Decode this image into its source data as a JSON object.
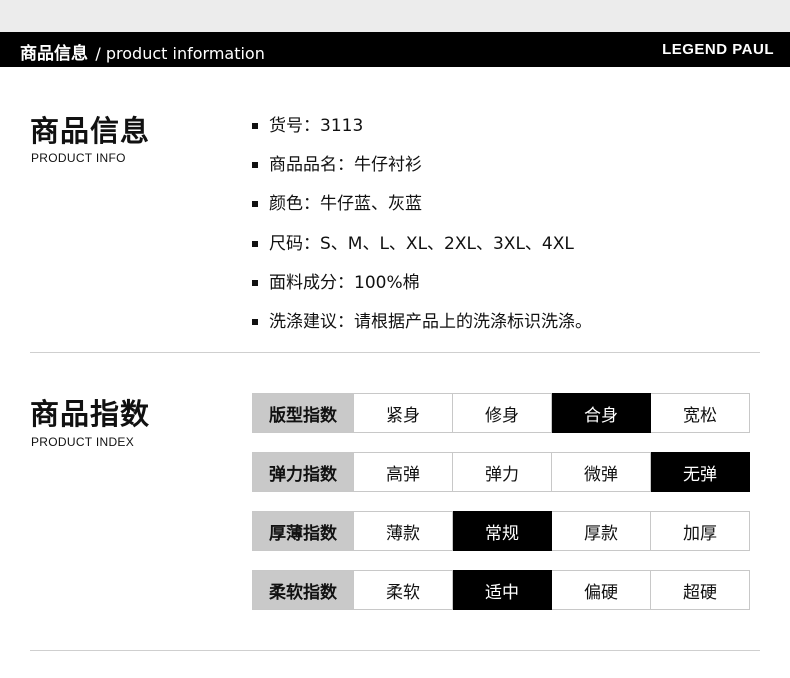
{
  "header": {
    "title_cn": "商品信息",
    "title_en": "/ product information",
    "brand": "LEGEND PAUL"
  },
  "info_section": {
    "title": "商品信息",
    "subtitle": "PRODUCT INFO",
    "items": [
      "货号：3113",
      "商品品名：牛仔衬衫",
      "颜色：牛仔蓝、灰蓝",
      "尺码：S、M、L、XL、2XL、3XL、4XL",
      "面料成分：100%棉",
      "洗涤建议：请根据产品上的洗涤标识洗涤。"
    ]
  },
  "index_section": {
    "title": "商品指数",
    "subtitle": "PRODUCT INDEX",
    "rows": [
      {
        "label": "版型指数",
        "options": [
          "紧身",
          "修身",
          "合身",
          "宽松"
        ],
        "selected": "合身"
      },
      {
        "label": "弹力指数",
        "options": [
          "高弹",
          "弹力",
          "微弹",
          "无弹"
        ],
        "selected": "无弹"
      },
      {
        "label": "厚薄指数",
        "options": [
          "薄款",
          "常规",
          "厚款",
          "加厚"
        ],
        "selected": "常规"
      },
      {
        "label": "柔软指数",
        "options": [
          "柔软",
          "适中",
          "偏硬",
          "超硬"
        ],
        "selected": "适中"
      }
    ]
  }
}
